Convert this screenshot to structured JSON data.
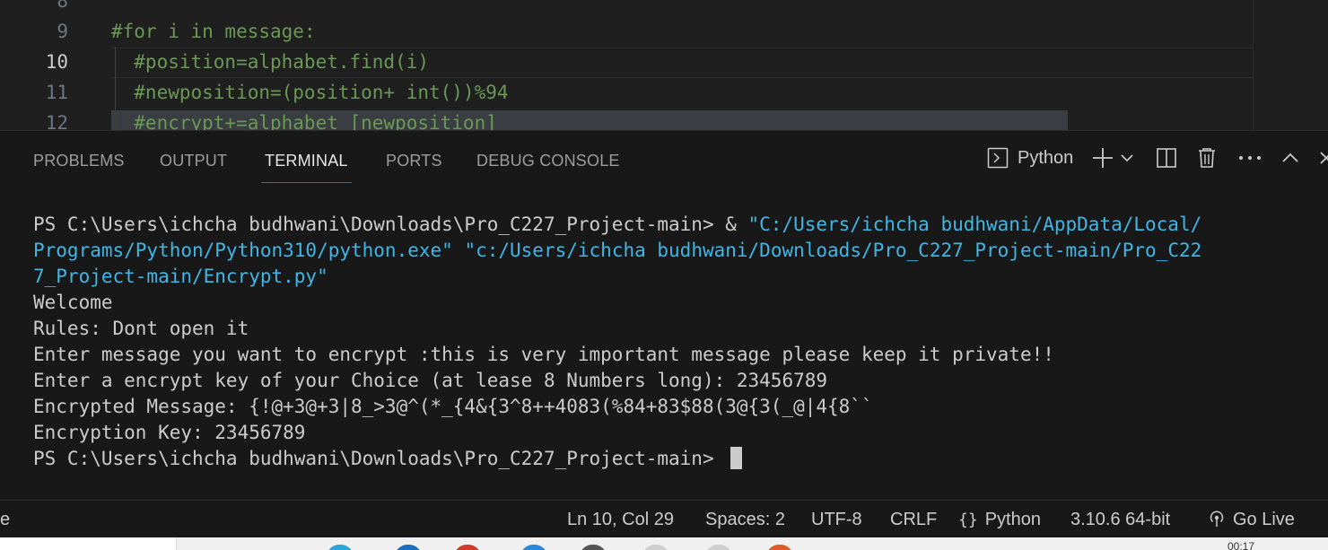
{
  "editor": {
    "partial_top_line_number": "8",
    "lines": [
      {
        "number": "9",
        "code": "#for i in message:"
      },
      {
        "number": "10",
        "code": "  #position=alphabet.find(i)"
      },
      {
        "number": "11",
        "code": "  #newposition=(position+ int())%94"
      },
      {
        "number": "12",
        "code": "  #encrypt+=alphabet [newposition]"
      }
    ]
  },
  "panel": {
    "tabs": [
      {
        "label": "PROBLEMS"
      },
      {
        "label": "OUTPUT"
      },
      {
        "label": "TERMINAL"
      },
      {
        "label": "PORTS"
      },
      {
        "label": "DEBUG CONSOLE"
      }
    ],
    "active_tab": "TERMINAL",
    "terminal_profile_label": "Python"
  },
  "terminal": {
    "cmd_prefix": "PS C:\\Users\\ichcha budhwani\\Downloads\\Pro_C227_Project-main> & ",
    "cmd_arg1_a": "\"C:/Users/ichcha budhwani/AppData/Local/",
    "cmd_arg1_b": "Programs/Python/Python310/python.exe\"",
    "cmd_space": " ",
    "cmd_arg2_a": "\"c:/Users/ichcha budhwani/Downloads/Pro_C227_Project-main/Pro_C22",
    "cmd_arg2_b": "7_Project-main/Encrypt.py\"",
    "output_lines": [
      "Welcome",
      "Rules: Dont open it",
      "Enter message you want to encrypt :this is very important message please keep it private!!",
      "Enter a encrypt key of your Choice (at lease 8 Numbers long): 23456789",
      "Encrypted Message: {!@+3@+3|8_>3@^(*_{4&{3^8++4083(%84+83$88(3@{3(_@|4{8``",
      "Encryption Key: 23456789"
    ],
    "final_prompt": "PS C:\\Users\\ichcha budhwani\\Downloads\\Pro_C227_Project-main> "
  },
  "statusbar": {
    "left_fragment": "e",
    "position": "Ln 10, Col 29",
    "spaces": "Spaces: 2",
    "encoding": "UTF-8",
    "eol": "CRLF",
    "language": "Python",
    "interpreter": "3.10.6 64-bit",
    "go_live": "Go Live"
  },
  "taskbar": {
    "clock_fragment": "00:17"
  },
  "colors": {
    "editor_bg": "#1f1f1f",
    "panel_bg": "#181818",
    "comment_green": "#6a9955",
    "string_blue": "#3fb6e5",
    "active_tab_underline": "#0078d4"
  }
}
